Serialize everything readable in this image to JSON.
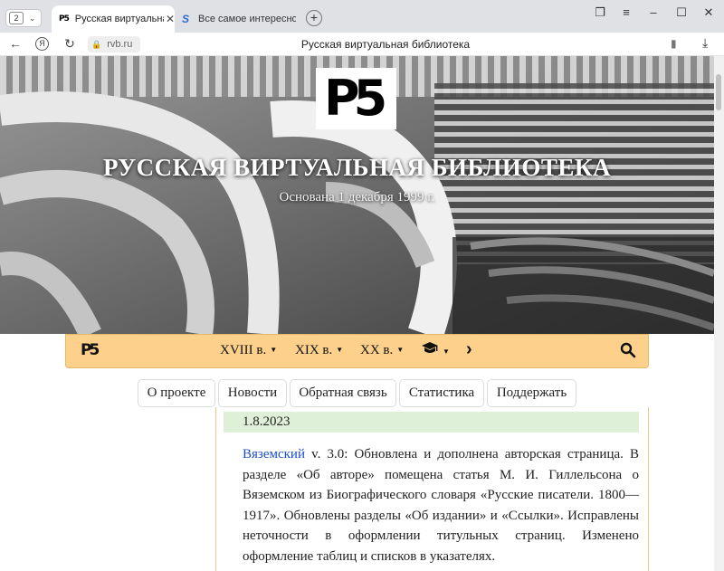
{
  "browser": {
    "tab_count": "2",
    "tabs": [
      {
        "title": "Русская виртуальная би",
        "active": true
      },
      {
        "title": "Все самое интересное из",
        "active": false
      }
    ],
    "url": "rvb.ru",
    "page_title": "Русская виртуальная библиотека"
  },
  "hero": {
    "logo_text": "Р5",
    "title": "РУССКАЯ ВИРТУАЛЬНАЯ БИБЛИОТЕКА",
    "subtitle": "Основана 1 декабря 1999 г."
  },
  "navbar": {
    "logo_text": "Р5",
    "items": [
      {
        "label": "XVIII в."
      },
      {
        "label": "XIX в."
      },
      {
        "label": "XX в."
      }
    ]
  },
  "subnav": {
    "items": [
      {
        "label": "О проекте"
      },
      {
        "label": "Новости"
      },
      {
        "label": "Обратная связь"
      },
      {
        "label": "Статистика"
      },
      {
        "label": "Поддержать"
      }
    ]
  },
  "news": {
    "date": "1.8.2023",
    "author_link": "Вяземский",
    "body": " v. 3.0: Обновлена и дополнена авторская страница. В разделе «Об авторе» помещена статья М. И. Гиллельсона о Вяземском из Биографического словаря «Русские писатели. 1800—1917». Обновлены разделы «Об издании» и «Ссылки». Исправлены неточности в оформлении титульных страниц. Изменено оформление таблиц и списков в указателях."
  },
  "colors": {
    "navbar_bg": "#fdd18b",
    "date_row_bg": "#dff0d8",
    "link": "#1a4fc9",
    "content_border": "#f0c78a"
  }
}
